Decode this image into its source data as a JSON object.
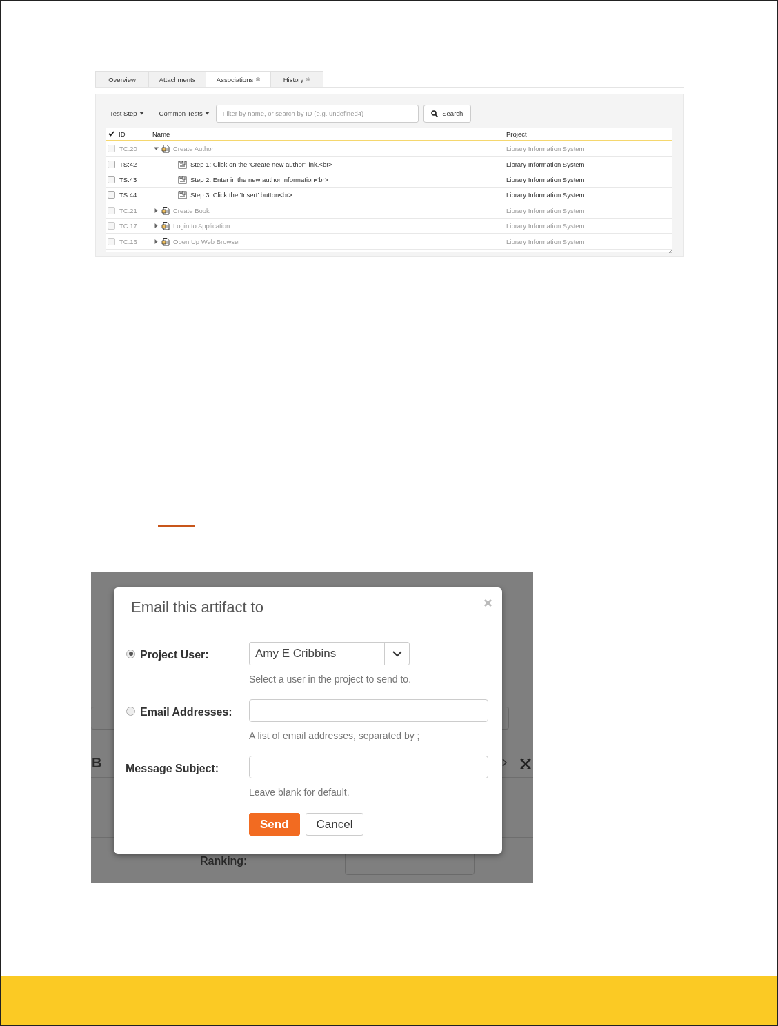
{
  "associations_screenshot": {
    "tabs": [
      {
        "label": "Overview",
        "selected": false,
        "has_indicator": false
      },
      {
        "label": "Attachments",
        "selected": false,
        "has_indicator": false
      },
      {
        "label": "Associations",
        "selected": true,
        "has_indicator": true
      },
      {
        "label": "History",
        "selected": false,
        "has_indicator": true
      }
    ],
    "toolbar": {
      "menus": [
        {
          "label": "Test Step"
        },
        {
          "label": "Common Tests"
        }
      ],
      "filter": {
        "placeholder": "Filter by name, or search by ID (e.g. undefined4)"
      },
      "search_button": "Search"
    },
    "table": {
      "columns": [
        "ID",
        "Name",
        "Project"
      ],
      "rows": [
        {
          "kind": "test_case",
          "checked": false,
          "id": "TC:20",
          "name": "Create Author",
          "project": "Library Information System",
          "expanded": true,
          "children": [
            {
              "kind": "test_step",
              "checked": false,
              "id": "TS:42",
              "name": "Step 1: Click on the 'Create new author' link.<br>",
              "project": "Library Information System"
            },
            {
              "kind": "test_step",
              "checked": false,
              "id": "TS:43",
              "name": "Step 2: Enter in the new author information<br>",
              "project": "Library Information System"
            },
            {
              "kind": "test_step",
              "checked": false,
              "id": "TS:44",
              "name": "Step 3: Click the 'Insert' button<br>",
              "project": "Library Information System"
            }
          ]
        },
        {
          "kind": "test_case",
          "checked": false,
          "id": "TC:21",
          "name": "Create Book",
          "project": "Library Information System",
          "expanded": false
        },
        {
          "kind": "test_case",
          "checked": false,
          "id": "TC:17",
          "name": "Login to Application",
          "project": "Library Information System",
          "expanded": false
        },
        {
          "kind": "test_case",
          "checked": false,
          "id": "TC:16",
          "name": "Open Up Web Browser",
          "project": "Library Information System",
          "expanded": false
        }
      ]
    }
  },
  "email_dialog_screenshot": {
    "background": {
      "toolbar_letter": "B",
      "ranking_label": "Ranking:"
    },
    "dialog": {
      "title": "Email this artifact to",
      "fields": [
        {
          "kind": "select",
          "label": "Project User:",
          "selected": true,
          "value": "Amy E Cribbins",
          "help": "Select a user in the project to send to."
        },
        {
          "kind": "text",
          "label": "Email Addresses:",
          "selected": false,
          "help": "A list of email addresses, separated by ;"
        },
        {
          "kind": "text",
          "label": "Message Subject:",
          "help": "Leave blank for default."
        }
      ],
      "buttons": [
        {
          "label": "Send",
          "kind": "primary"
        },
        {
          "label": "Cancel",
          "kind": "default"
        }
      ]
    }
  }
}
